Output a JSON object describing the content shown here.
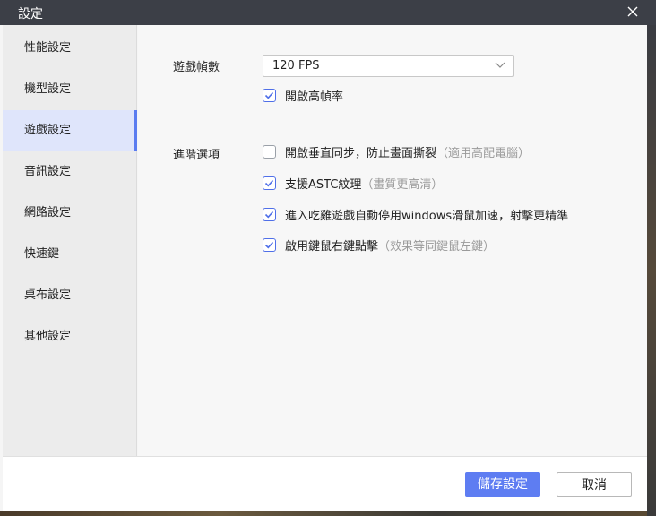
{
  "window": {
    "title": "設定"
  },
  "sidebar": {
    "items": [
      {
        "label": "性能設定",
        "active": false
      },
      {
        "label": "機型設定",
        "active": false
      },
      {
        "label": "遊戲設定",
        "active": true
      },
      {
        "label": "音訊設定",
        "active": false
      },
      {
        "label": "網路設定",
        "active": false
      },
      {
        "label": "快速鍵",
        "active": false
      },
      {
        "label": "桌布設定",
        "active": false
      },
      {
        "label": "其他設定",
        "active": false
      }
    ]
  },
  "game": {
    "fps_label": "遊戲幀數",
    "fps_value": "120 FPS",
    "high_fps": {
      "label": "開啟高幀率",
      "checked": true
    },
    "advanced_label": "進階選項",
    "options": [
      {
        "label": "開啟垂直同步，防止畫面撕裂",
        "note": "（適用高配電腦）",
        "checked": false
      },
      {
        "label": "支援ASTC紋理",
        "note": "（畫質更高清）",
        "checked": true
      },
      {
        "label": "進入吃雞遊戲自動停用windows滑鼠加速，射擊更精準",
        "note": "",
        "checked": true
      },
      {
        "label": "啟用鍵鼠右鍵點擊",
        "note": "（效果等同鍵鼠左鍵）",
        "checked": true
      }
    ]
  },
  "footer": {
    "save_label": "儲存設定",
    "cancel_label": "取消"
  },
  "colors": {
    "accent": "#5e7df2",
    "titlebar": "#3c3f47",
    "sidebar_active": "#dfe5fb"
  }
}
